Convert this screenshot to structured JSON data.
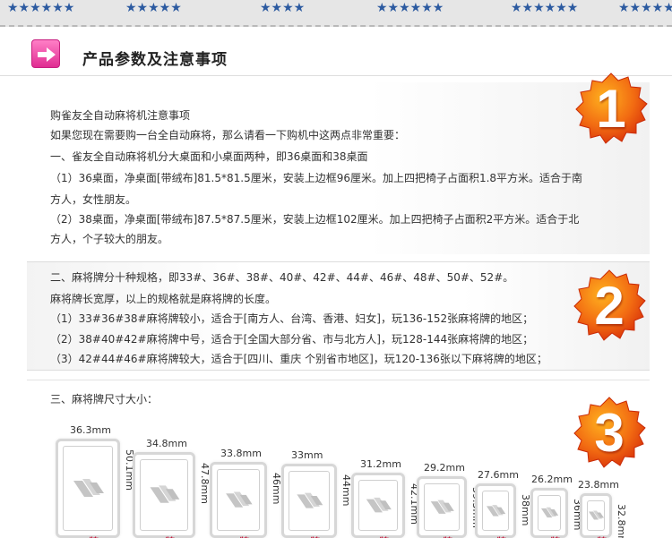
{
  "colors": {
    "accent_pink": "#e02d92",
    "badge_red": "#e63a10",
    "badge_orange": "#f7a21b",
    "star_blue": "#2c5aa0",
    "caption_red": "#c3183c"
  },
  "banner": {
    "star_icon": "star-icon",
    "star_groups": [
      "★★★★★★",
      "★★★★★",
      "★★★★",
      "★★★★★★",
      "★★★★★★",
      "★★★★★",
      "★★★★★★"
    ]
  },
  "header": {
    "arrow_icon": "arrow-right-icon",
    "title": "产品参数及注意事项"
  },
  "sections": [
    {
      "badge": "1",
      "lines": [
        "购雀友全自动麻将机注意事项",
        "如果您现在需要购一台全自动麻将，那么请看一下购机中这两点非常重要：",
        "一、雀友全自动麻将机分大桌面和小桌面两种，即36桌面和38桌面",
        "（1）36桌面，净桌面[带绒布]81.5*81.5厘米，安装上边框96厘米。加上四把椅子占面积1.8平方米。适合于南",
        "方人，女性朋友。",
        "（2）38桌面，净桌面[带绒布]87.5*87.5厘米，安装上边框102厘米。加上四把椅子占面积2平方米。适合于北",
        "方人，个子较大的朋友。"
      ]
    },
    {
      "badge": "2",
      "lines": [
        "二、麻将牌分十种规格，即33#、36#、38#、40#、42#、44#、46#、48#、50#、52#。",
        "麻将牌长宽厚，以上的规格就是麻将牌的长度。",
        "（1）33#36#38#麻将牌较小，适合于[南方人、台湾、香港、妇女]，玩136-152张麻将牌的地区；",
        "（2）38#40#42#麻将牌中号，适合于[全国大部分省、市与北方人]，玩128-144张麻将牌的地区；",
        "（3）42#44#46#麻将牌较大，适合于[四川、重庆 个别省市地区]，玩120-136张以下麻将牌的地区；"
      ]
    },
    {
      "badge": "3",
      "lines": [
        "三、麻将牌尺寸大小："
      ],
      "tile_icon": "mahjong-tile-icon",
      "tiles": [
        {
          "width": "36.3mm",
          "height": "50.1mm",
          "caption": "50牌"
        },
        {
          "width": "34.8mm",
          "height": "47.8mm",
          "caption": "48牌"
        },
        {
          "width": "33.8mm",
          "height": "46mm",
          "caption": "46牌"
        },
        {
          "width": "33mm",
          "height": "44mm",
          "caption": "44牌"
        },
        {
          "width": "31.2mm",
          "height": "42.1mm",
          "caption": "42牌"
        },
        {
          "width": "29.2mm",
          "height": "39.5mm",
          "caption": "40牌"
        },
        {
          "width": "27.6mm",
          "height": "38mm",
          "caption": "38牌"
        },
        {
          "width": "26.2mm",
          "height": "36mm",
          "caption": "36牌"
        },
        {
          "width": "23.8mm",
          "height": "32.8mm",
          "caption": "33牌"
        }
      ]
    }
  ]
}
